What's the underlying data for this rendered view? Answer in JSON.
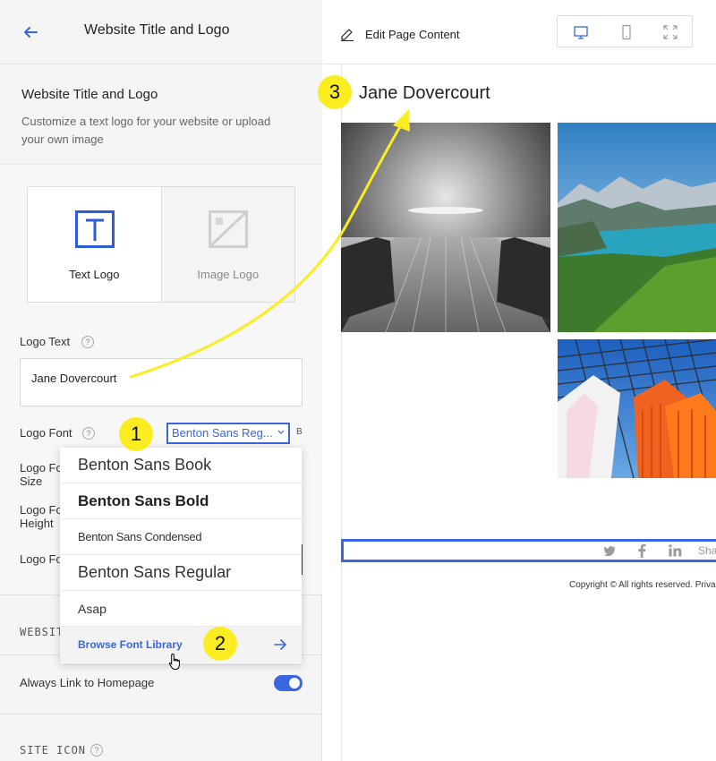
{
  "left_panel": {
    "header_title": "Website Title and Logo",
    "section_title": "Website Title and Logo",
    "section_desc": "Customize a text logo for your website or upload your own image",
    "options": {
      "text_logo": "Text Logo",
      "image_logo": "Image Logo"
    },
    "logo_text_label": "Logo Text",
    "logo_text_value": "Jane Dovercourt",
    "logo_font_label": "Logo Font",
    "logo_font_value": "Benton Sans Reg...",
    "b_tag": "B",
    "truncated_labels": [
      "Logo Fo Size",
      "Logo Fo Height",
      "Logo Fo"
    ],
    "section_heading_website": "WEBSIT",
    "always_link_label": "Always Link to Homepage",
    "always_link_on": true,
    "site_icon_heading": "SITE ICON",
    "help_glyph": "?"
  },
  "font_dropdown": {
    "items": [
      {
        "label": "Benton Sans Book"
      },
      {
        "label": "Benton Sans Bold"
      },
      {
        "label": "Benton Sans Condensed"
      },
      {
        "label": "Benton Sans Regular"
      },
      {
        "label": "Asap"
      }
    ],
    "browse_label": "Browse Font Library"
  },
  "right_panel": {
    "edit_label": "Edit Page Content",
    "site_title": "Jane Dovercourt",
    "social_share": "Sha",
    "copyright": "Copyright © All rights reserved. Priva"
  },
  "annotations": {
    "badge1": "1",
    "badge2": "2",
    "badge3": "3"
  },
  "colors": {
    "accent": "#3a66e0",
    "annotation_yellow": "#fbed21"
  }
}
